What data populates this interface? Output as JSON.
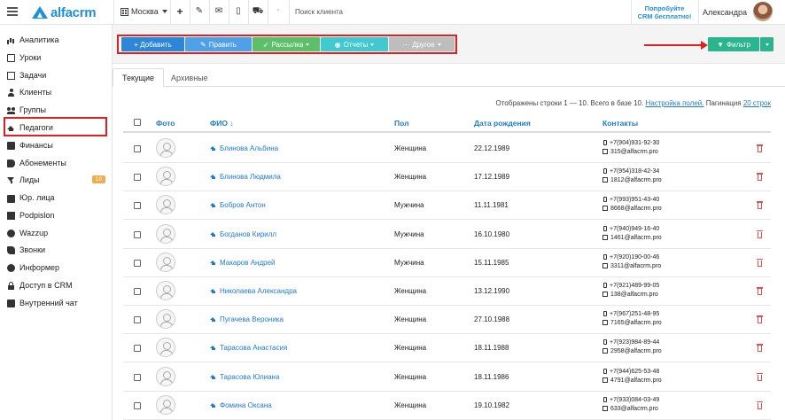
{
  "header": {
    "logo_text": "alfacrm",
    "city": "Москва",
    "search_placeholder": "Поиск клиента",
    "promo_line1": "Попробуйте",
    "promo_line2": "CRM бесплатно!",
    "user_name": "Александра"
  },
  "sidebar": {
    "items": [
      {
        "label": "Аналитика",
        "icon": "bar-chart-icon"
      },
      {
        "label": "Уроки",
        "icon": "book-icon"
      },
      {
        "label": "Задачи",
        "icon": "task-icon"
      },
      {
        "label": "Клиенты",
        "icon": "user-icon"
      },
      {
        "label": "Группы",
        "icon": "group-icon"
      },
      {
        "label": "Педагоги",
        "icon": "graduation-cap-icon"
      },
      {
        "label": "Финансы",
        "icon": "money-icon"
      },
      {
        "label": "Абонементы",
        "icon": "tag-icon"
      },
      {
        "label": "Лиды",
        "icon": "funnel-icon",
        "badge": "10"
      },
      {
        "label": "Юр. лица",
        "icon": "briefcase-icon"
      },
      {
        "label": "Podpislon",
        "icon": "document-icon"
      },
      {
        "label": "Wazzup",
        "icon": "chat-icon"
      },
      {
        "label": "Звонки",
        "icon": "phone-icon"
      },
      {
        "label": "Информер",
        "icon": "info-icon"
      },
      {
        "label": "Доступ в CRM",
        "icon": "lock-icon"
      },
      {
        "label": "Внутренний чат",
        "icon": "message-icon"
      }
    ]
  },
  "toolbar": {
    "add_label": "+ Добавить",
    "edit_label": "Править",
    "mailing_label": "Рассылка",
    "reports_label": "Отчеты",
    "other_label": "Другое",
    "filter_label": "Фильтр"
  },
  "tabs": {
    "current": "Текущие",
    "archived": "Архивные"
  },
  "info": {
    "rows_text": "Отображены строки 1 — 10. Всего в базе 10.",
    "settings_link": "Настройка полей.",
    "pagination_label": "Пагинация",
    "pagination_value": "20 строк"
  },
  "table": {
    "headers": {
      "photo": "Фото",
      "name": "ФИО ↓",
      "gender": "Пол",
      "birth": "Дата рождения",
      "contacts": "Контакты"
    },
    "rows": [
      {
        "name": "Блинова Альбина",
        "gender": "Женщина",
        "birth": "22.12.1989",
        "phone": "+7(904)931-92-30",
        "email": "315@alfacrm.pro"
      },
      {
        "name": "Блинова Людмила",
        "gender": "Женщина",
        "birth": "17.12.1989",
        "phone": "+7(954)318-42-34",
        "email": "1812@alfacrm.pro"
      },
      {
        "name": "Бобров Антон",
        "gender": "Мужчина",
        "birth": "11.11.1981",
        "phone": "+7(993)951-43-40",
        "email": "8668@alfacrm.pro"
      },
      {
        "name": "Богданов Кирилл",
        "gender": "Мужчина",
        "birth": "16.10.1980",
        "phone": "+7(940)949-16-40",
        "email": "1461@alfacrm.pro"
      },
      {
        "name": "Макаров Андрей",
        "gender": "Мужчина",
        "birth": "15.11.1985",
        "phone": "+7(920)190-00-46",
        "email": "3311@alfacrm.pro"
      },
      {
        "name": "Николаева Александра",
        "gender": "Женщина",
        "birth": "13.12.1990",
        "phone": "+7(921)489-99-05",
        "email": "138@alfacrm.pro"
      },
      {
        "name": "Пугачева Вероника",
        "gender": "Женщина",
        "birth": "27.10.1988",
        "phone": "+7(967)251-48-95",
        "email": "7165@alfacrm.pro"
      },
      {
        "name": "Тарасова Анастасия",
        "gender": "Женщина",
        "birth": "18.11.1988",
        "phone": "+7(923)984-89-44",
        "email": "2958@alfacrm.pro"
      },
      {
        "name": "Тарасова Юлиана",
        "gender": "Женщина",
        "birth": "18.11.1986",
        "phone": "+7(944)625-53-48",
        "email": "4791@alfacrm.pro"
      },
      {
        "name": "Фомина Оксана",
        "gender": "Женщина",
        "birth": "19.10.1982",
        "phone": "+7(933)084-03-49",
        "email": "633@alfacrm.pro"
      }
    ]
  }
}
